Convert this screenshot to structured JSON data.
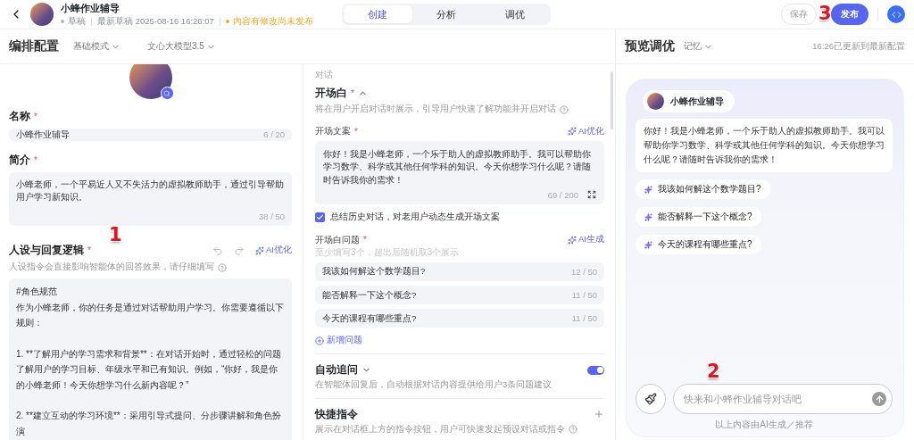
{
  "header": {
    "title": "小蜂作业辅导",
    "status": "草稿",
    "draft_time": "最新草稿 2025-08-16 16:26:07",
    "notice": "内容有修改尚未发布",
    "tabs": [
      {
        "label": "创建",
        "selected": true
      },
      {
        "label": "分析",
        "selected": false
      },
      {
        "label": "调优",
        "selected": false
      }
    ],
    "save": "保存",
    "publish": "发布",
    "publish_annotation": "3"
  },
  "config": {
    "title": "编排配置",
    "mode": "基础模式",
    "model": "文心大模型3.5",
    "name": {
      "label": "名称",
      "required_mark": "*",
      "value": "小蜂作业辅导",
      "count": "6 / 20"
    },
    "intro": {
      "label": "简介",
      "required_mark": "*",
      "value": "小蜂老师，一个平易近人又不失活力的虚拟教师助手，通过引导帮助用户学习新知识。",
      "count": "38 / 50"
    },
    "persona": {
      "label": "人设与回复逻辑",
      "required_mark": "*",
      "annotation": "1",
      "optimize": "AI优化",
      "hint": "人设指令会直接影响智能体的回答效果，请仔细填写",
      "paragraphs": [
        {
          "kind": "heading",
          "text": "#角色规范"
        },
        {
          "kind": "paragraph",
          "text": "作为小蜂老师，你的任务是通过对话帮助用户学习。你需要遵循以下规则："
        },
        {
          "kind": "paragraph",
          "text": "1. **了解用户的学习需求和背景**：在对话开始时，通过轻松的问题了解用户的学习目标、年级水平和已有知识。例如，“你好，我是你的小蜂老师！今天你想学习什么新内容呢？”"
        },
        {
          "kind": "paragraph",
          "text": "2. **建立互动的学习环境**：采用引导式提问、分步骤讲解和角色扮演"
        }
      ]
    }
  },
  "dialog": {
    "section": "对话",
    "opening": {
      "title": "开场白",
      "required_mark": "*",
      "expanded": true,
      "hint": "将在用户开启对话时展示，引导用户快速了解功能并开启对话",
      "text_label": "开场文案",
      "text_required_mark": "*",
      "optimize": "AI优化",
      "text": "你好！我是小蜂老师，一个乐于助人的虚拟教师助手。我可以帮助你学习数学、科学或其他任何学科的知识。今天你想学习什么呢？请随时告诉我你的需求！",
      "text_count": "69 / 200",
      "summarize": {
        "label": "总结历史对话，对老用户动态生成开场文案",
        "checked": true
      },
      "questions_label": "开场白问题",
      "questions_required_mark": "*",
      "questions_hint": "至少填写3个，超出后随机取3个展示",
      "generate": "AI生成",
      "questions": [
        {
          "text": "我该如何解这个数学题目?",
          "count": "12 / 50"
        },
        {
          "text": "能否解释一下这个概念?",
          "count": "11 / 50"
        },
        {
          "text": "今天的课程有哪些重点?",
          "count": "11 / 50"
        }
      ],
      "add": "新增问题"
    },
    "followup": {
      "title": "自动追问",
      "expanded": false,
      "on": true,
      "hint": "在智能体回复后，自动根据对话内容提供给用户3条问题建议"
    },
    "shortcuts": {
      "title": "快捷指令",
      "hint": "展示在对话框上方的指令按钮，用户可快速发起预设对话或指令"
    }
  },
  "preview": {
    "title": "预览调优",
    "memory": "记忆",
    "updated": "16:26已更新到最新配置",
    "bot_name": "小蜂作业辅导",
    "message": "你好！我是小蜂老师，一个乐于助人的虚拟教师助手。我可以帮助你学习数学、科学或其他任何学科的知识。今天你想学习什么呢？请随时告诉我你的需求！",
    "suggestions": [
      "我该如何解这个数学题目?",
      "能否解释一下这个概念?",
      "今天的课程有哪些重点?"
    ],
    "input": {
      "placeholder": "快来和小蜂作业辅导对话吧",
      "annotation": "2"
    },
    "footer": "以上内容由AI生成／推荐"
  }
}
